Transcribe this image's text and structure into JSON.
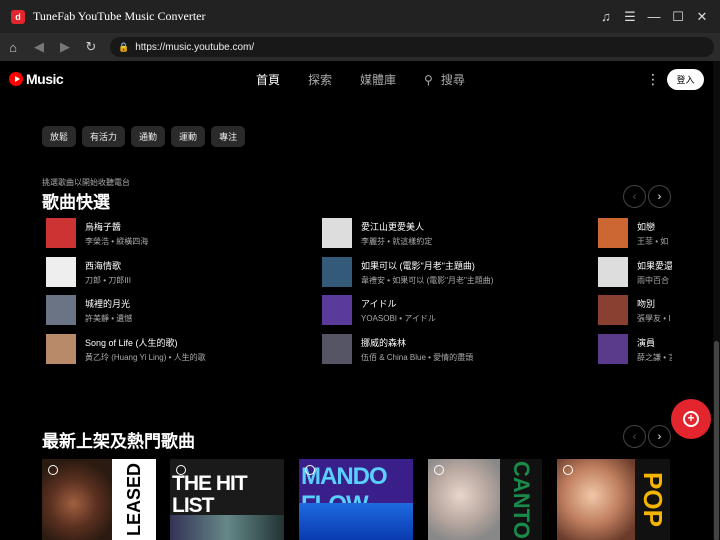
{
  "app": {
    "title": "TuneFab YouTube Music Converter",
    "logo_letter": "d"
  },
  "browser": {
    "url": "https://music.youtube.com/"
  },
  "yt": {
    "logo_text": "Music",
    "nav": [
      "首頁",
      "探索",
      "媒體庫"
    ],
    "search_label": "搜尋",
    "signin": "登入"
  },
  "chips": [
    "放鬆",
    "有活力",
    "通勤",
    "運動",
    "專注"
  ],
  "quick_picks": {
    "subtitle": "挑選歌曲以開始收聽電台",
    "title": "歌曲快選",
    "columns": [
      [
        {
          "title": "烏梅子醬",
          "sub": "李榮浩 • 縱橫四海",
          "color": "#c33"
        },
        {
          "title": "西海情歌",
          "sub": "刀郎 • 刀郎III",
          "color": "#eee"
        },
        {
          "title": "城裡的月光",
          "sub": "許美靜 • 遺憾",
          "color": "#6a7484"
        },
        {
          "title": "Song of Life (人生的歌)",
          "sub": "黃乙玲 (Huang Yi Ling) • 人生的歌",
          "color": "#b98a6a"
        }
      ],
      [
        {
          "title": "愛江山更愛美人",
          "sub": "李麗芬 • 就這樣約定",
          "color": "#ddd"
        },
        {
          "title": "如果可以 (電影\"月老\"主題曲)",
          "sub": "韋禮安 • 如果可以 (電影\"月老\"主題曲)",
          "color": "#345a7a"
        },
        {
          "title": "アイドル",
          "sub": "YOASOBI • アイドル",
          "color": "#5a3a9a"
        },
        {
          "title": "挪威的森林",
          "sub": "伍佰 & China Blue • 愛情的盡頭",
          "color": "#556"
        }
      ],
      [
        {
          "title": "如戀",
          "sub": "王菲 • 如",
          "color": "#c63"
        },
        {
          "title": "如果愛還",
          "sub": "雨中百合",
          "color": "#ddd"
        },
        {
          "title": "吻別",
          "sub": "張學友 • I",
          "color": "#8a4030"
        },
        {
          "title": "演員",
          "sub": "薛之謙 • 言",
          "color": "#5a3a8a"
        }
      ]
    ]
  },
  "new_releases": {
    "title": "最新上架及熱門歌曲",
    "albums": [
      {
        "label": "LEASED",
        "bg": "#2a1a10",
        "accent": "#fff"
      },
      {
        "label": "THE HIT LIST",
        "bg": "#1a1a1a",
        "accent": "#fff"
      },
      {
        "label": "MANDO FLOW",
        "bg": "#3a1f8a",
        "accent": "#5ad0ff"
      },
      {
        "label": "CANTO",
        "bg": "#d8d8d8",
        "accent": "#1a8a4a"
      },
      {
        "label": "POP",
        "bg": "#8a5a3a",
        "accent": "#f5b400"
      }
    ]
  }
}
